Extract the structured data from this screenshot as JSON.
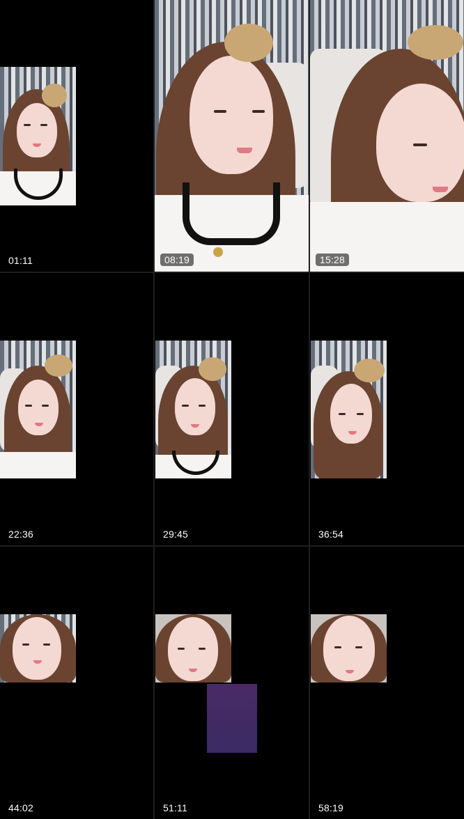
{
  "timestamps": [
    "01:11",
    "08:19",
    "15:28",
    "22:36",
    "29:45",
    "36:54",
    "44:02",
    "51:11",
    "58:19"
  ]
}
